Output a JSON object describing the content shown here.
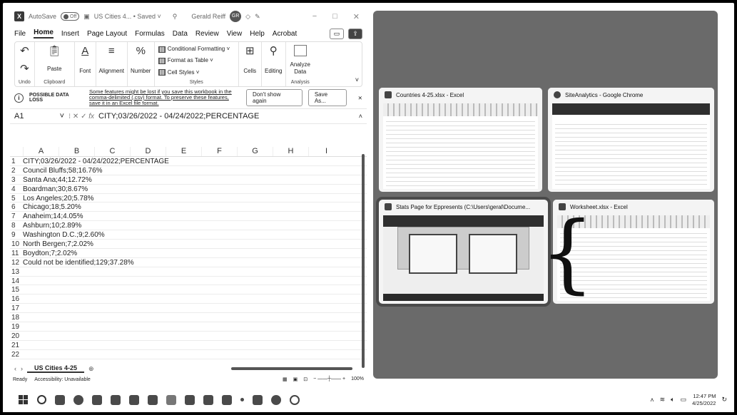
{
  "excel": {
    "titlebar": {
      "autosave": "AutoSave",
      "toggle": "Off",
      "doc": "US Cities 4... • Saved ˅",
      "user": "Gerald Reiff",
      "initials": "GR"
    },
    "tabs": [
      "File",
      "Home",
      "Insert",
      "Page Layout",
      "Formulas",
      "Data",
      "Review",
      "View",
      "Help",
      "Acrobat"
    ],
    "active_tab": "Home",
    "ribbon": {
      "undo": "Undo",
      "paste": "Paste",
      "clipboard": "Clipboard",
      "font": "Font",
      "alignment": "Alignment",
      "number": "Number",
      "cond_format": "Conditional Formatting ˅",
      "format_table": "Format as Table ˅",
      "cell_styles": "Cell Styles ˅",
      "styles": "Styles",
      "cells": "Cells",
      "editing": "Editing",
      "analyze": "Analyze Data",
      "analysis": "Analysis"
    },
    "notice": {
      "title": "POSSIBLE DATA LOSS",
      "message": "Some features might be lost if you save this workbook in the comma-delimited (.csv) format. To preserve these features, save it in an Excel file format.",
      "btn_dont": "Don't show again",
      "btn_save": "Save As..."
    },
    "namebox": "A1",
    "formula": "CITY;03/26/2022 - 04/24/2022;PERCENTAGE",
    "columns": [
      "A",
      "B",
      "C",
      "D",
      "E",
      "F",
      "G",
      "H",
      "I"
    ],
    "rows": [
      {
        "n": "1",
        "a": "CITY;03/26/2022 - 04/24/2022;PERCENTAGE"
      },
      {
        "n": "2",
        "a": "Council Bluffs;58;16.76%"
      },
      {
        "n": "3",
        "a": "Santa Ana;44;12.72%"
      },
      {
        "n": "4",
        "a": "Boardman;30;8.67%"
      },
      {
        "n": "5",
        "a": "Los Angeles;20;5.78%"
      },
      {
        "n": "6",
        "a": "Chicago;18;5.20%"
      },
      {
        "n": "7",
        "a": "Anaheim;14;4.05%"
      },
      {
        "n": "8",
        "a": "Ashburn;10;2.89%"
      },
      {
        "n": "9",
        "a": "Washington D.C.;9;2.60%"
      },
      {
        "n": "10",
        "a": "North Bergen;7;2.02%"
      },
      {
        "n": "11",
        "a": "Boydton;7;2.02%"
      },
      {
        "n": "12",
        "a": "Could not be identified;129;37.28%"
      },
      {
        "n": "13",
        "a": ""
      },
      {
        "n": "14",
        "a": ""
      },
      {
        "n": "15",
        "a": ""
      },
      {
        "n": "16",
        "a": ""
      },
      {
        "n": "17",
        "a": ""
      },
      {
        "n": "18",
        "a": ""
      },
      {
        "n": "19",
        "a": ""
      },
      {
        "n": "20",
        "a": ""
      },
      {
        "n": "21",
        "a": ""
      },
      {
        "n": "22",
        "a": ""
      }
    ],
    "sheet_tab": "US Cities 4-25",
    "status": {
      "ready": "Ready",
      "accessibility": "Accessibility: Unavailable",
      "zoom": "100%"
    }
  },
  "switcher": {
    "windows": [
      {
        "title": "Countries 4-25.xlsx - Excel"
      },
      {
        "title": "SiteAnalytics - Google Chrome"
      },
      {
        "title": "Stats Page for Eppresents (C:\\Users\\geral\\Docume..."
      },
      {
        "title": "Worksheet.xlsx - Excel"
      }
    ]
  },
  "taskbar": {
    "time": "12:47 PM",
    "date": "4/25/2022"
  }
}
